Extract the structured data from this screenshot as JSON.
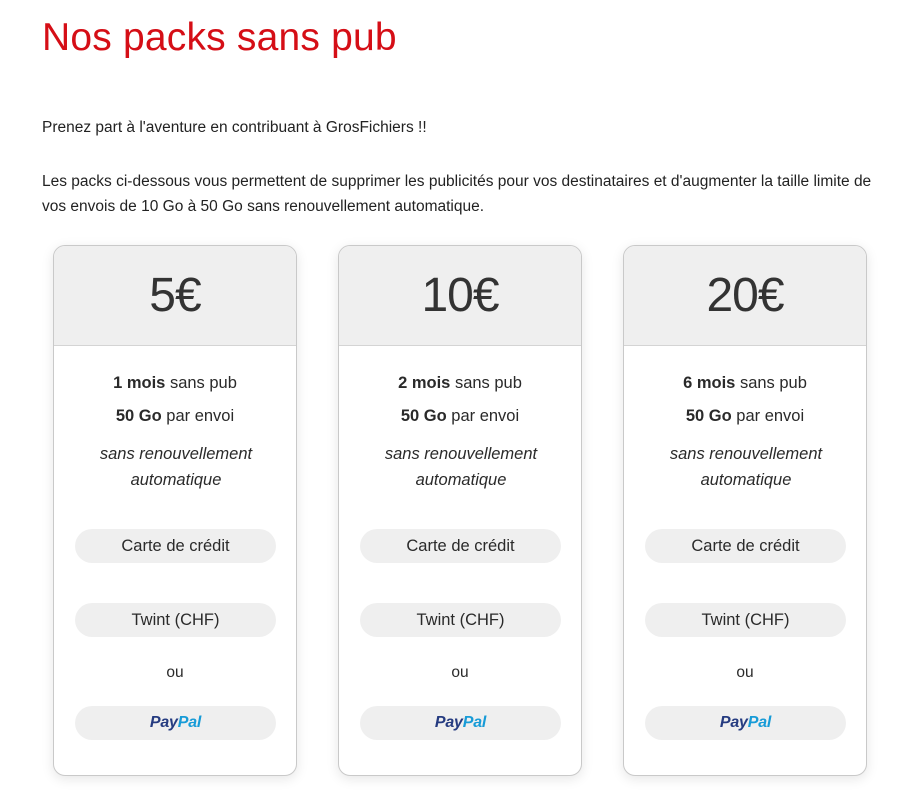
{
  "page": {
    "title": "Nos packs sans pub",
    "intro": "Prenez part à l'aventure en contribuant à GrosFichiers !!",
    "description": "Les packs ci-dessous vous permettent de supprimer les publicités pour vos destinataires et d'augmenter la taille limite de vos envois de 10 Go à 50 Go sans renouvellement automatique.",
    "accent_color": "#d50e16"
  },
  "packs": [
    {
      "price": "5€",
      "duration_bold": "1 mois",
      "duration_rest": " sans pub",
      "size_bold": "50 Go",
      "size_rest": " par envoi",
      "note": "sans renouvellement automatique",
      "card_label": "Carte de crédit",
      "twint_label": "Twint (CHF)",
      "or_label": "ou",
      "paypal_pay": "Pay",
      "paypal_pal": "Pal"
    },
    {
      "price": "10€",
      "duration_bold": "2 mois",
      "duration_rest": " sans pub",
      "size_bold": "50 Go",
      "size_rest": " par envoi",
      "note": "sans renouvellement automatique",
      "card_label": "Carte de crédit",
      "twint_label": "Twint (CHF)",
      "or_label": "ou",
      "paypal_pay": "Pay",
      "paypal_pal": "Pal"
    },
    {
      "price": "20€",
      "duration_bold": "6 mois",
      "duration_rest": " sans pub",
      "size_bold": "50 Go",
      "size_rest": " par envoi",
      "note": "sans renouvellement automatique",
      "card_label": "Carte de crédit",
      "twint_label": "Twint (CHF)",
      "or_label": "ou",
      "paypal_pay": "Pay",
      "paypal_pal": "Pal"
    }
  ]
}
